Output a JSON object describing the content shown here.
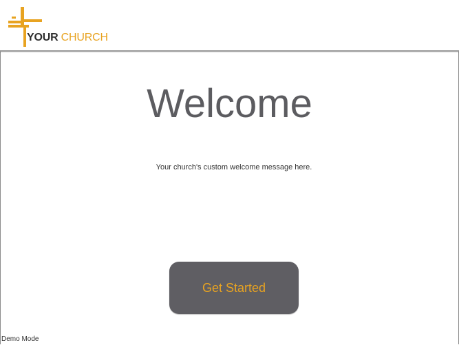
{
  "header": {
    "logo": {
      "icon": "cross-logo-icon",
      "name_strong": "YOUR",
      "name_light": " CHURCH",
      "accent_color": "#e8a321"
    }
  },
  "main": {
    "title": "Welcome",
    "message": "Your church's custom welcome message here.",
    "start_button_label": "Get Started"
  },
  "footer": {
    "mode_label": "Demo Mode"
  },
  "colors": {
    "accent": "#e8a321",
    "button_bg": "#5f5e63",
    "title_text": "#5c5c60"
  }
}
